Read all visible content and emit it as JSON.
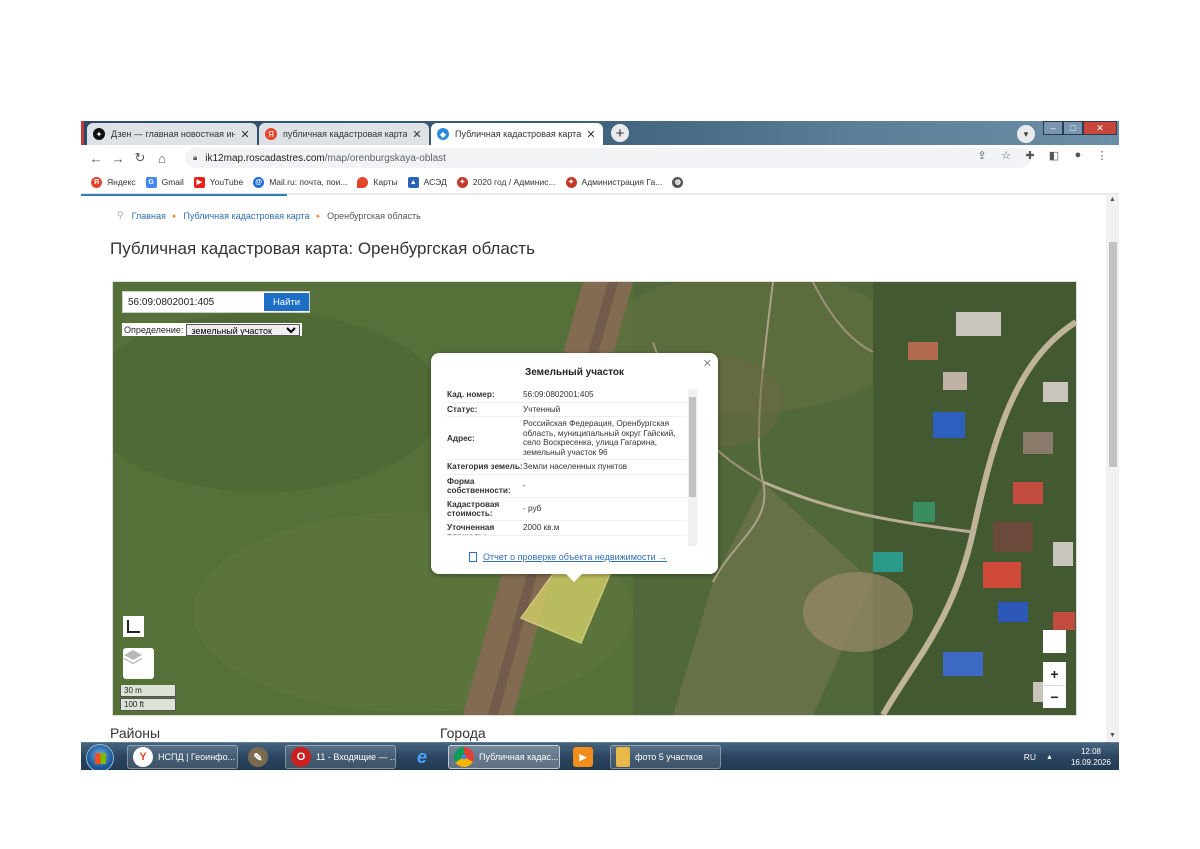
{
  "tabs": [
    {
      "title": "Дзен — главная новостная инф",
      "icon": "zen-icon",
      "color": "#111111"
    },
    {
      "title": "публичная кадастровая карта о",
      "icon": "yandex-icon",
      "color": "#e2452b"
    },
    {
      "title": "Публичная кадастровая карта: (",
      "icon": "roscadastres-icon",
      "color": "#2b8bd6"
    }
  ],
  "address": {
    "host": "ik12map.roscadastres.com",
    "path": "/map/orenburgskaya-oblast"
  },
  "bookmarks": [
    {
      "label": "Яндекс",
      "color": "#e2452b"
    },
    {
      "label": "Gmail",
      "color": "#4285f4"
    },
    {
      "label": "YouTube",
      "color": "#e62117"
    },
    {
      "label": "Mail.ru: почта, пои...",
      "color": "#1f6fd6"
    },
    {
      "label": "Карты",
      "color": "#e2452b"
    },
    {
      "label": "АСЭД",
      "color": "#2a64b8"
    },
    {
      "label": "2020 год / Админис...",
      "color": "#c0392b"
    },
    {
      "label": "Администрация Га...",
      "color": "#c0392b"
    },
    {
      "label": "",
      "color": "#555555"
    }
  ],
  "breadcrumbs": {
    "home": "Главная",
    "section": "Публичная кадастровая карта",
    "current": "Оренбургская область"
  },
  "page_title": "Публичная кадастровая карта: Оренбургская область",
  "search": {
    "value": "56:09:0802001:405",
    "button": "Найти"
  },
  "definition": {
    "label": "Определение:",
    "selected": "земельный участок"
  },
  "popup": {
    "title": "Земельный участок",
    "rows": [
      {
        "key": "Кад. номер:",
        "value": "56:09:0802001:405"
      },
      {
        "key": "Статус:",
        "value": "Учтенный"
      },
      {
        "key": "Адрес:",
        "value": "Российская Федерация, Оренбургская область, муниципальный округ Гайский, село Воскресенка, улица Гагарина, земельный участок 96"
      },
      {
        "key": "Категория земель:",
        "value": "Земли населенных пунктов"
      },
      {
        "key": "Форма собственности:",
        "value": "-"
      },
      {
        "key": "Кадастровая стоимость:",
        "value": "- руб"
      },
      {
        "key": "Уточненная площадь:",
        "value": "2000 кв.м"
      }
    ],
    "link": "Отчет о проверке объекта недвижимости →"
  },
  "scale": {
    "metric": "30 m",
    "imperial": "100 ft"
  },
  "zoom": {
    "in": "+",
    "out": "−"
  },
  "below_headings": {
    "left": "Районы",
    "right": "Города"
  },
  "taskbar": {
    "items": [
      {
        "label": "НСПД | Геоинфо...",
        "color": "#e2452b",
        "glyph": "Y"
      },
      {
        "label": "",
        "color": "#7a6a4f",
        "glyph": "✎"
      },
      {
        "label": "11 - Входящие — ...",
        "color": "#cc1f1f",
        "glyph": "O"
      },
      {
        "label": "",
        "color": "#1e7bd6",
        "glyph": "e"
      },
      {
        "label": "Публичная кадас...",
        "color": "#2f9e44",
        "glyph": "◉"
      },
      {
        "label": "",
        "color": "#f28c1a",
        "glyph": "▶"
      },
      {
        "label": "фото 5 участков",
        "color": "#e8b84a",
        "glyph": "▮"
      }
    ],
    "language": "RU",
    "time": "12:08",
    "date": "16.09.2026"
  }
}
